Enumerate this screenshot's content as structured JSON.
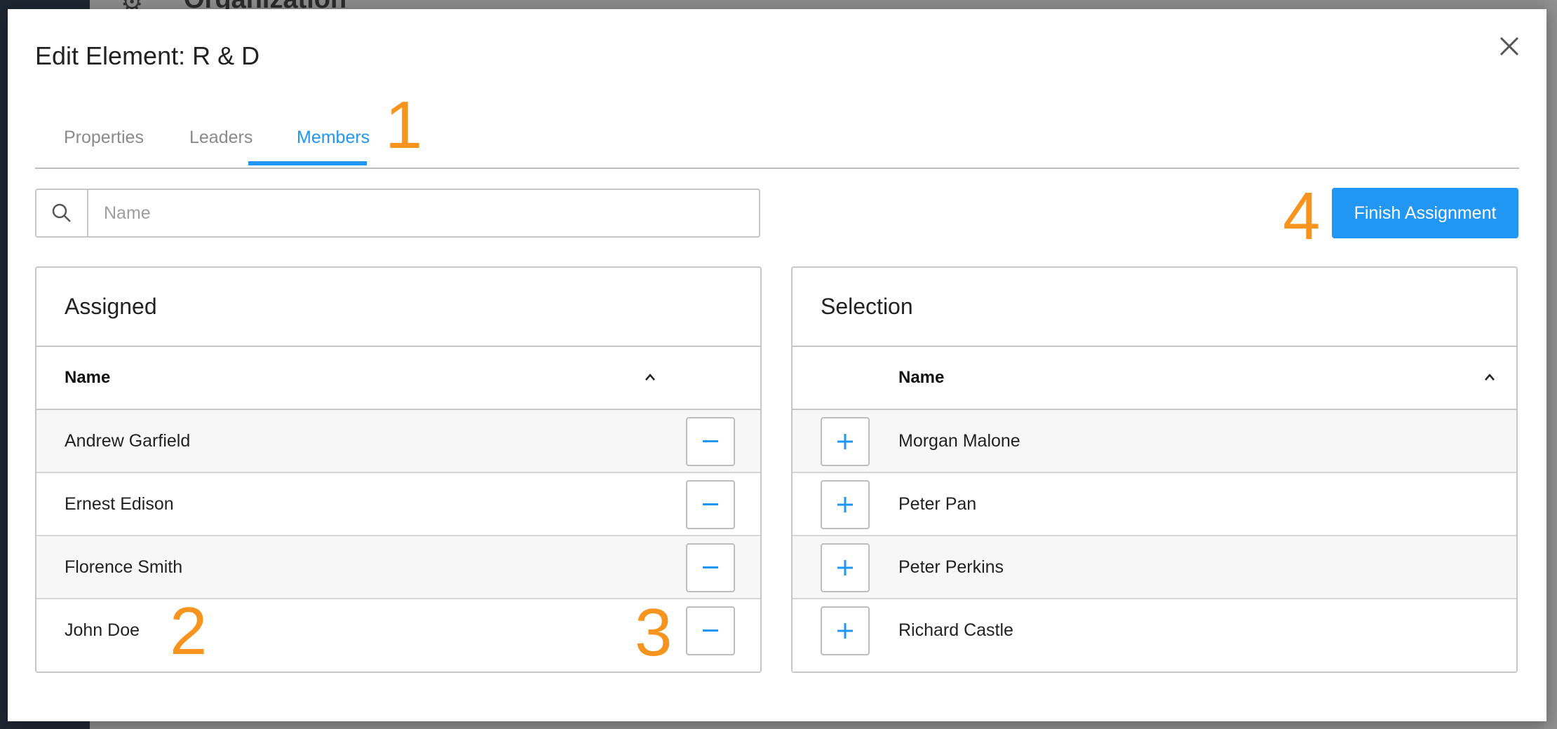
{
  "background": {
    "page_title": "Organization"
  },
  "dialog": {
    "title": "Edit Element: R & D",
    "tabs": [
      {
        "label": "Properties",
        "active": false
      },
      {
        "label": "Leaders",
        "active": false
      },
      {
        "label": "Members",
        "active": true
      }
    ],
    "search": {
      "placeholder": "Name",
      "value": ""
    },
    "finish_label": "Finish Assignment",
    "annotations": [
      "1",
      "2",
      "3",
      "4"
    ]
  },
  "assigned": {
    "title": "Assigned",
    "column": "Name",
    "rows": [
      "Andrew Garfield",
      "Ernest Edison",
      "Florence Smith",
      "John Doe"
    ]
  },
  "selection": {
    "title": "Selection",
    "column": "Name",
    "rows": [
      "Morgan Malone",
      "Peter Pan",
      "Peter Perkins",
      "Richard Castle"
    ]
  },
  "colors": {
    "accent": "#2196f3",
    "annotation": "#f7941d"
  }
}
